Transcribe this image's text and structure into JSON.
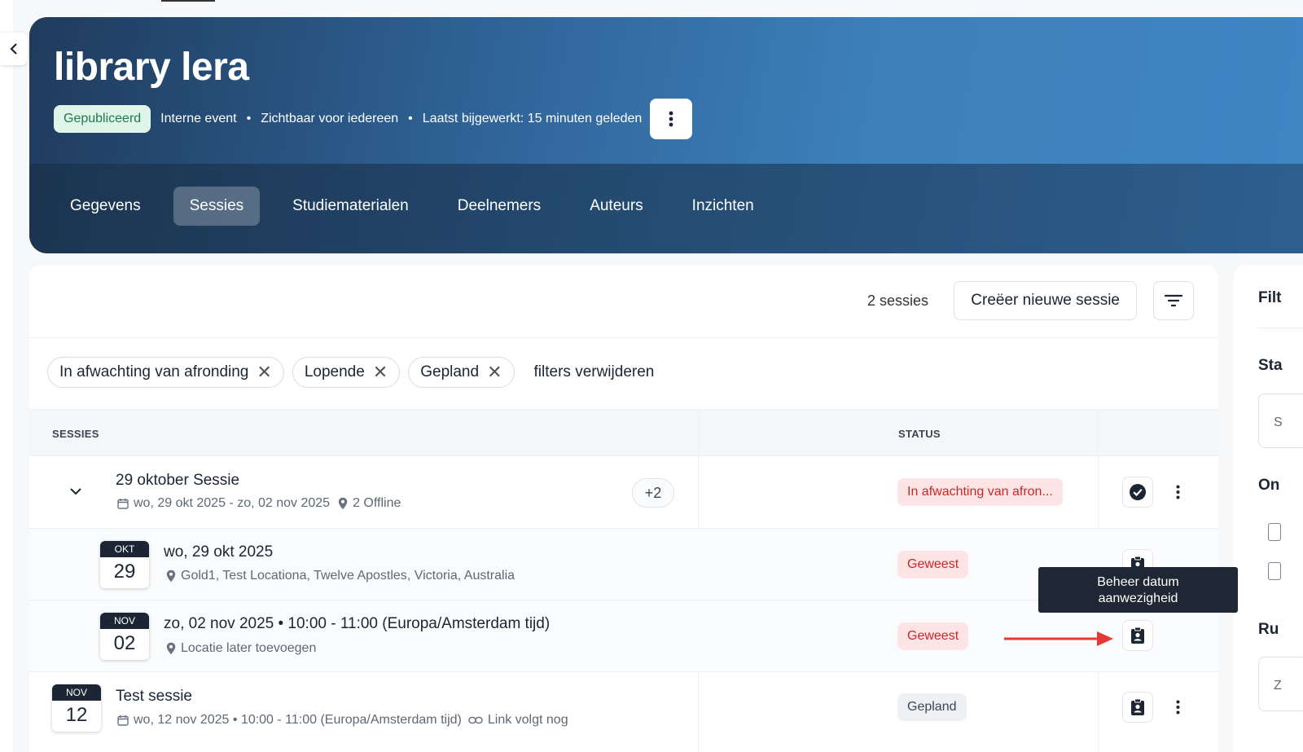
{
  "header": {
    "title": "library lera",
    "status_badge": "Gepubliceerd",
    "event_type": "Interne event",
    "visibility": "Zichtbaar voor iedereen",
    "last_updated": "Laatst bijgewerkt: 15 minuten geleden",
    "separator": "•"
  },
  "tabs": [
    {
      "label": "Gegevens"
    },
    {
      "label": "Sessies",
      "active": true
    },
    {
      "label": "Studiematerialen"
    },
    {
      "label": "Deelnemers"
    },
    {
      "label": "Auteurs"
    },
    {
      "label": "Inzichten"
    }
  ],
  "toolbar": {
    "count": "2 sessies",
    "create_label": "Creëer nieuwe sessie"
  },
  "filters": {
    "chips": [
      "In afwachting van afronding",
      "Lopende",
      "Gepland"
    ],
    "clear_label": "filters verwijderen"
  },
  "table": {
    "col_sessions": "SESSIES",
    "col_status": "STATUS",
    "rows": [
      {
        "title": "29 oktober Sessie",
        "dates": "wo, 29 okt 2025 - zo, 02 nov 2025",
        "location": "2 Offline",
        "extra": "+2",
        "status": "In afwachting van afron..."
      },
      {
        "month": "OKT",
        "day": "29",
        "title": "wo, 29 okt 2025",
        "location": "Gold1, Test Locationa, Twelve Apostles, Victoria, Australia",
        "status": "Geweest"
      },
      {
        "month": "NOV",
        "day": "02",
        "title": "zo, 02 nov 2025 • 10:00 - 11:00 (Europa/Amsterdam tijd)",
        "location": "Locatie later toevoegen",
        "status": "Geweest"
      },
      {
        "month": "NOV",
        "day": "12",
        "title": "Test sessie",
        "dates": "wo, 12 nov 2025 • 10:00 - 11:00 (Europa/Amsterdam tijd)",
        "link": "Link volgt nog",
        "status": "Gepland"
      }
    ]
  },
  "tooltip": {
    "line1": "Beheer datum",
    "line2": "aanwezigheid"
  },
  "side_panel": {
    "heading1": "Filt",
    "heading2": "Sta",
    "heading3": "On",
    "heading4": "Ru",
    "box_text1": "S",
    "box_text2": "Z"
  },
  "colors": {
    "accent": "#3d80bb",
    "header_dark": "#1f3b5c",
    "status_red_bg": "#fde5e5",
    "status_red_text": "#c62828",
    "published_bg": "#dff5ea",
    "published_text": "#1f7a49",
    "annotation_arrow": "#e53935"
  }
}
